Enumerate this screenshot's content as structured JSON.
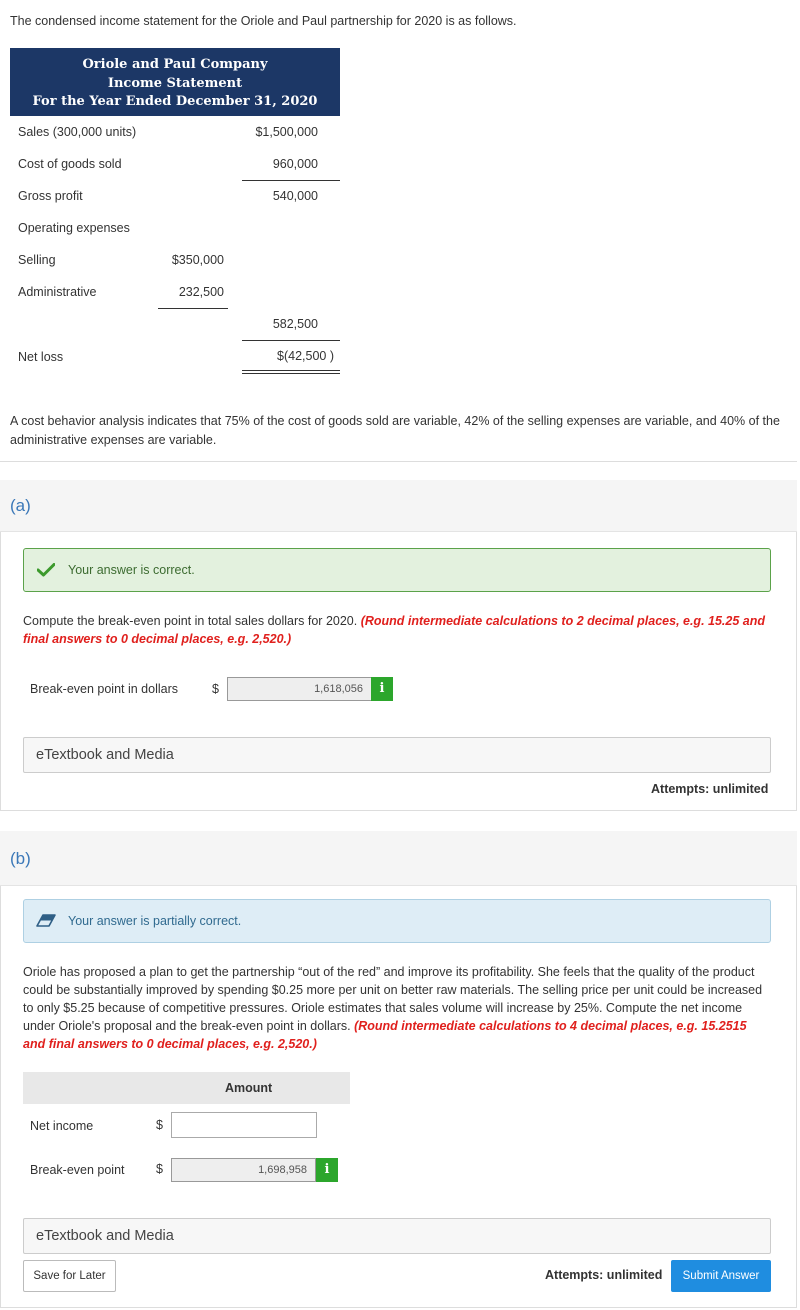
{
  "intro": "The condensed income statement for the Oriole and Paul partnership for 2020 is as follows.",
  "statement": {
    "company": "Oriole and Paul Company",
    "title": "Income Statement",
    "period": "For the Year Ended December 31, 2020",
    "sales_label": "Sales (300,000 units)",
    "sales_value": "$1,500,000",
    "cogs_label": "Cost of goods sold",
    "cogs_value": "960,000",
    "gross_label": "Gross profit",
    "gross_value": "540,000",
    "opex_label": "Operating expenses",
    "selling_label": "Selling",
    "selling_value": "$350,000",
    "admin_label": "Administrative",
    "admin_value": "232,500",
    "opex_total": "582,500",
    "net_label": "Net loss",
    "net_value": "$(42,500 )"
  },
  "cost_note": "A cost behavior analysis indicates that 75% of the cost of goods sold are variable, 42% of the selling expenses are variable, and 40% of the administrative expenses are variable.",
  "part_a": {
    "tag": "(a)",
    "status": "Your answer is correct.",
    "question": "Compute the break-even point in total sales dollars for 2020. ",
    "question_red": "(Round intermediate calculations to 2 decimal places, e.g. 15.25 and final answers to 0 decimal places, e.g. 2,520.)",
    "field_label": "Break-even point in dollars",
    "currency": "$",
    "answer": "1,618,056",
    "info": "i",
    "etextbook": "eTextbook and Media",
    "attempts": "Attempts: unlimited"
  },
  "part_b": {
    "tag": "(b)",
    "status": "Your answer is partially correct.",
    "question": "Oriole has proposed a plan to get the partnership “out of the red” and improve its profitability. She feels that the quality of the product could be substantially improved by spending $0.25 more per unit on better raw materials. The selling price per unit could be increased to only $5.25 because of competitive pressures. Oriole estimates that sales volume will increase by 25%. Compute the net income under Oriole's proposal and the break-even point in dollars. ",
    "question_red": "(Round intermediate calculations to 4 decimal places, e.g. 15.2515 and final answers to 0 decimal places, e.g. 2,520.)",
    "amount_header": "Amount",
    "net_income_label": "Net income",
    "net_income_value": "",
    "bep_label": "Break-even point",
    "currency": "$",
    "bep_value": "1,698,958",
    "info": "i",
    "etextbook": "eTextbook and Media",
    "save": "Save for Later",
    "attempts": "Attempts: unlimited",
    "submit": "Submit Answer"
  },
  "colors": {
    "header_bg": "#1c3766",
    "correct_bg": "#e3f1de",
    "partial_bg": "#deedf6",
    "info_green": "#2ca62c",
    "submit_blue": "#1f8de0",
    "red_hint": "#e0201d"
  }
}
